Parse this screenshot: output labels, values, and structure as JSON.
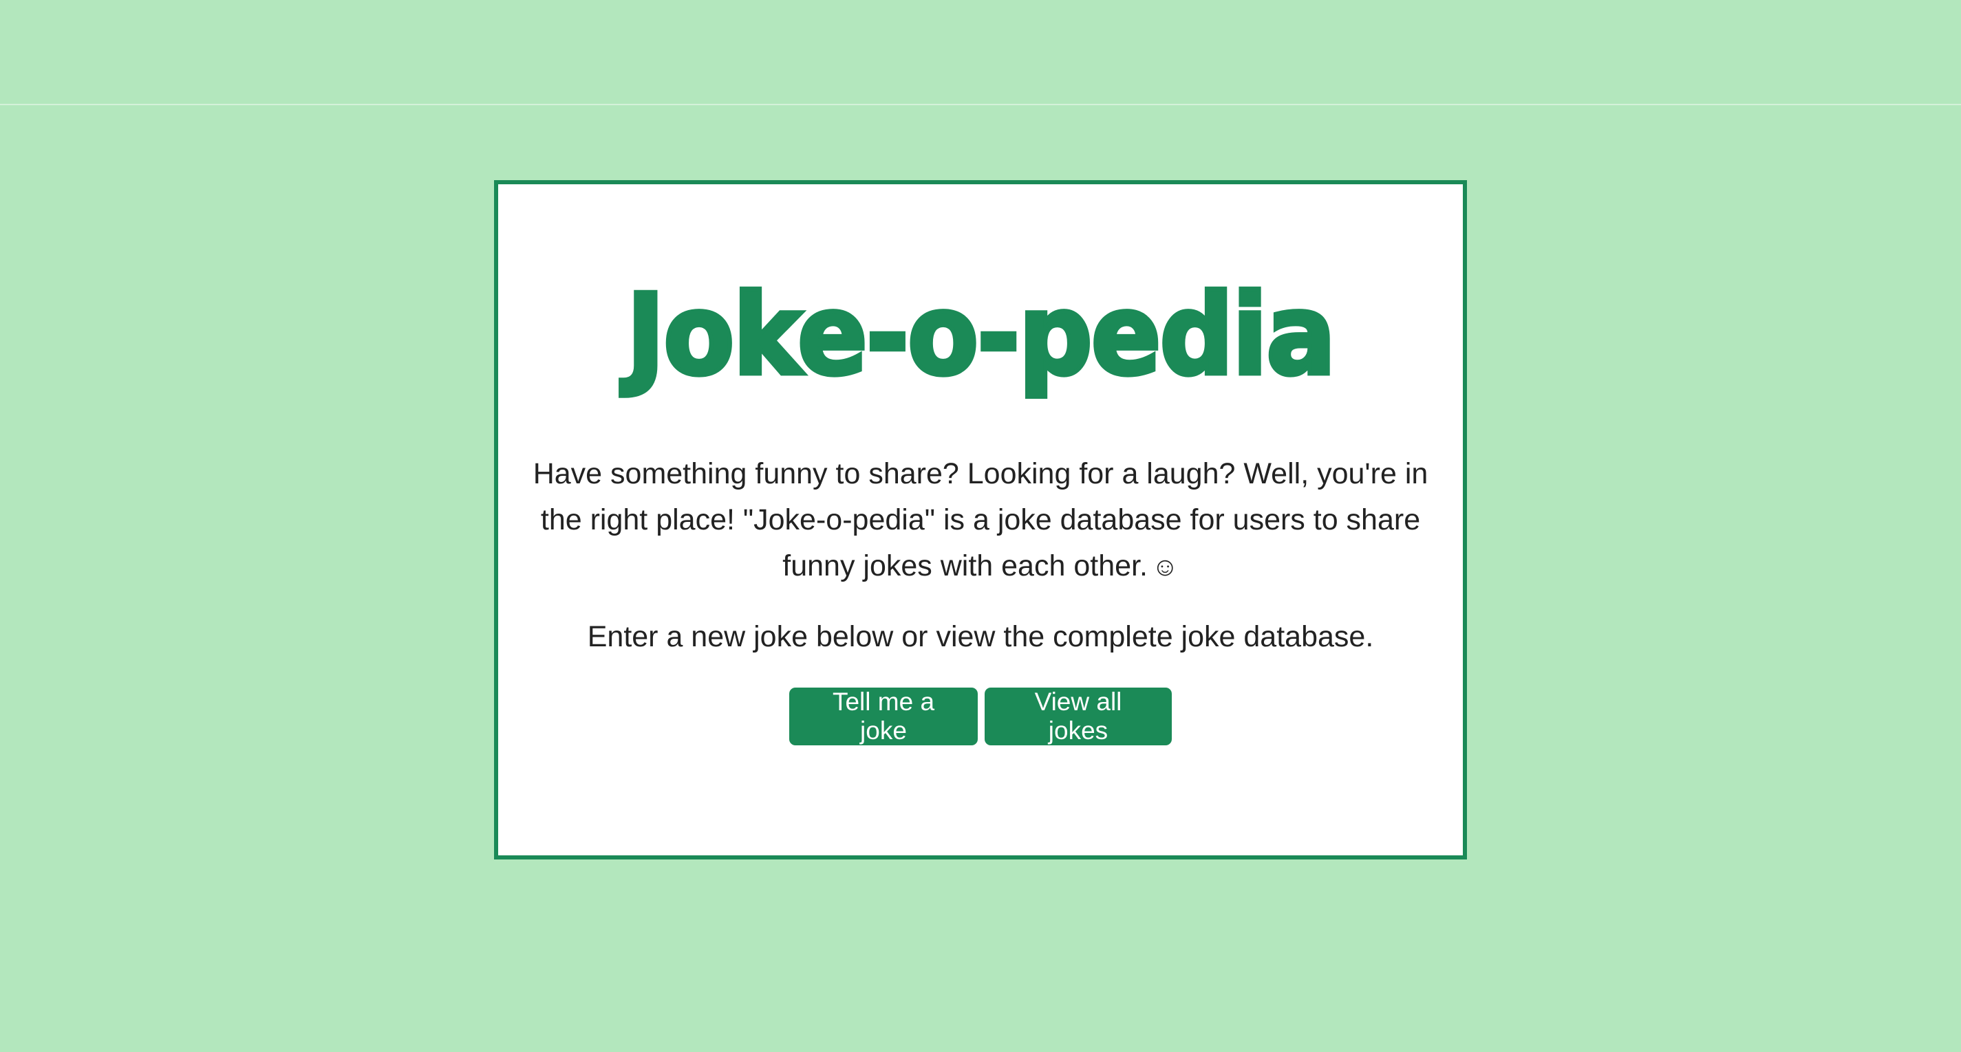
{
  "page": {
    "logo_text": "Joke-o-pedia",
    "intro_text": "Have something funny to share? Looking for a laugh? Well, you're in the right place! \"Joke-o-pedia\" is a joke database for users to share funny jokes with each other.",
    "smiley": "☺",
    "prompt_text": "Enter a new joke below or view the complete joke database."
  },
  "buttons": {
    "tell_joke_label": "Tell me a joke",
    "view_all_label": "View all jokes"
  },
  "colors": {
    "background": "#b3e7bd",
    "brand_green": "#1b8a57",
    "card": "#ffffff",
    "text": "#222222"
  }
}
